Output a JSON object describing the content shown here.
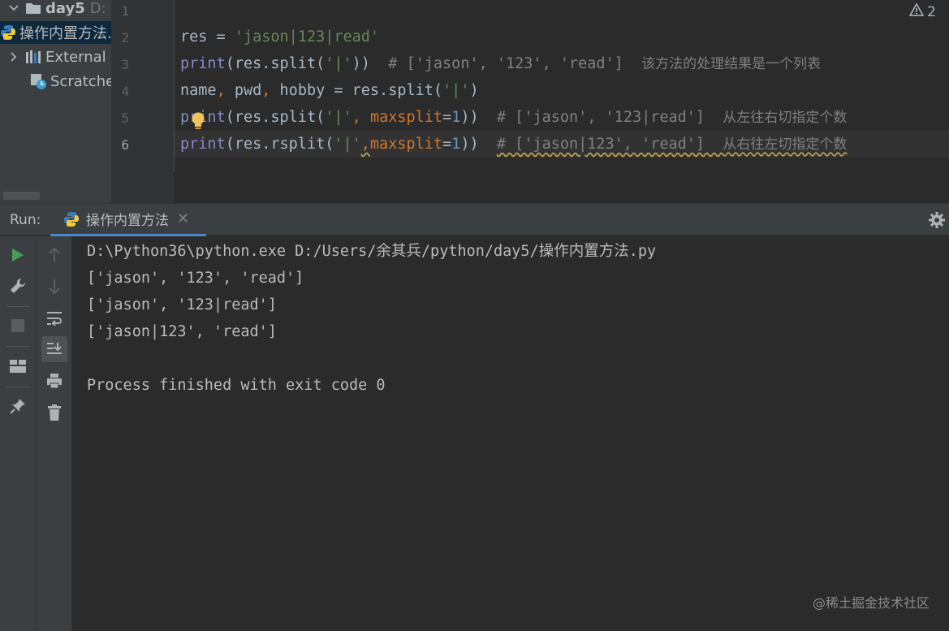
{
  "project_tree": {
    "folder_name": "day5",
    "folder_path_hint": "D:",
    "file_name": "操作内置方法.py",
    "external_libraries": "External Libraries",
    "scratches": "Scratches and Consoles"
  },
  "editor": {
    "inspection_count": "2",
    "lines": [
      {
        "num": "1"
      },
      {
        "num": "2",
        "var": "res",
        "op": " = ",
        "str": "'jason|123|read'"
      },
      {
        "num": "3",
        "fn": "print",
        "p1": "(res.split(",
        "str": "'|'",
        "p2": "))  ",
        "comment": "# ['jason', '123', 'read']  ",
        "comment_zh": "该方法的处理结果是一个列表"
      },
      {
        "num": "4",
        "text": "name",
        "c1": ",",
        "t2": " pwd",
        "c2": ",",
        "t3": " hobby = res.split(",
        "str": "'|'",
        "p2": ")"
      },
      {
        "num": "5",
        "fn": "print",
        "p1": "(res.split(",
        "str": "'|'",
        "c": ", ",
        "kwarg": "maxsplit",
        "eq": "=",
        "num_val": "1",
        "p2": "))  ",
        "comment": "# ['jason', '123|read']  ",
        "comment_zh": "从左往右切指定个数"
      },
      {
        "num": "6",
        "fn": "print",
        "p1": "(res.rsplit(",
        "str": "'|'",
        "c": ",",
        "kwarg": "maxsplit",
        "eq": "=",
        "num_val": "1",
        "p2": "))  ",
        "comment": "# ['jason|123', 'read']  ",
        "comment_zh": "从右往左切指定个数"
      }
    ]
  },
  "run": {
    "label": "Run:",
    "tab_title": "操作内置方法",
    "output": [
      "D:\\Python36\\python.exe D:/Users/余其兵/python/day5/操作内置方法.py",
      "['jason', '123', 'read']",
      "['jason', '123|read']",
      "['jason|123', 'read']",
      "",
      "Process finished with exit code 0"
    ]
  },
  "watermark": "@稀土掘金技术社区",
  "colors": {
    "accent": "#4a88c7",
    "run_green": "#499c54",
    "bulb": "#f2c55c"
  }
}
